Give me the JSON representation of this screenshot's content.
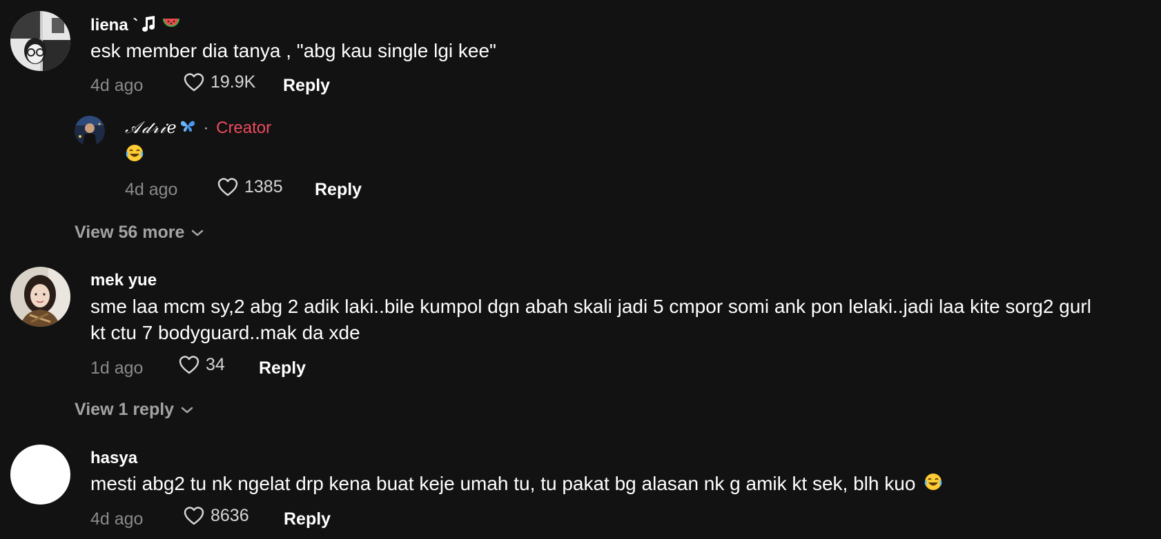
{
  "colors": {
    "background": "#121212",
    "primary_text": "#ffffff",
    "secondary_text": "#8a8a8a",
    "creator_accent": "#ee4b5f"
  },
  "comments": [
    {
      "username": "liena `",
      "username_icons": [
        "music-note-icon",
        "watermelon-icon"
      ],
      "text": "esk member dia tanya , \"abg kau single lgi kee\"",
      "time": "4d ago",
      "likes": "19.9K",
      "reply_label": "Reply",
      "replies": [
        {
          "username": "𝒜𝒹𝓇𝒾𝑒",
          "username_icons": [
            "butterfly-icon"
          ],
          "separator": "·",
          "creator_label": "Creator",
          "text_icons": [
            "laughing-emoji-icon"
          ],
          "time": "4d ago",
          "likes": "1385",
          "reply_label": "Reply"
        }
      ],
      "view_more_label": "View 56 more"
    },
    {
      "username": "mek yue",
      "text_line1": "sme laa mcm sy,2 abg 2 adik laki..bile kumpol dgn abah skali jadi 5 cmpor somi ank pon lelaki..jadi laa kite sorg2 gurl",
      "text_line2": "kt ctu 7 bodyguard..mak da xde",
      "time": "1d ago",
      "likes": "34",
      "reply_label": "Reply",
      "view_more_label": "View 1 reply"
    },
    {
      "username": "hasya",
      "text": "mesti abg2 tu nk ngelat drp kena buat keje umah tu, tu pakat bg alasan nk g amik kt sek, blh kuo",
      "text_icons": [
        "laughing-emoji-icon"
      ],
      "time": "4d ago",
      "likes": "8636",
      "reply_label": "Reply"
    }
  ]
}
